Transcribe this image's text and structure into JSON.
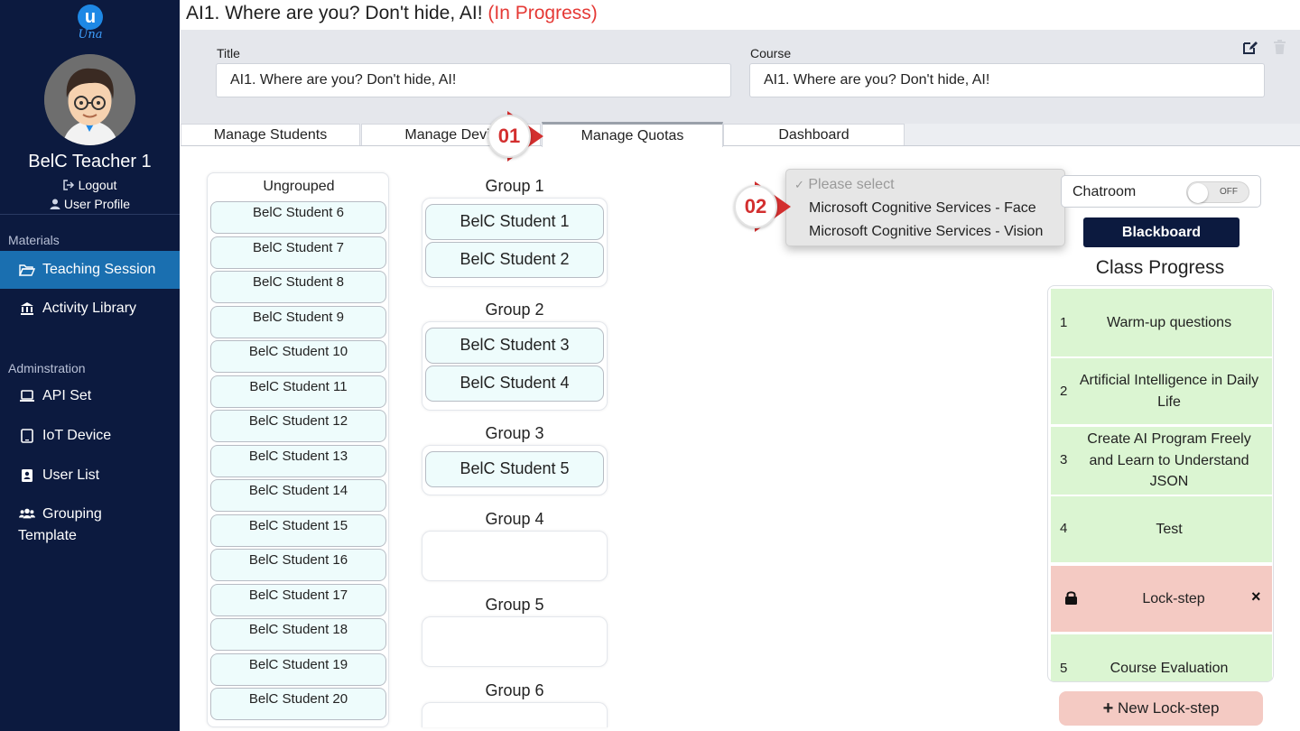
{
  "sidebar": {
    "logo_text": "Una",
    "teacher_name": "BelC Teacher 1",
    "logout_label": "Logout",
    "profile_label": "User Profile",
    "materials_label": "Materials",
    "admin_label": "Adminstration",
    "items": [
      {
        "label": "Teaching Session",
        "icon": "folder-open-icon",
        "active": true
      },
      {
        "label": "Activity Library",
        "icon": "library-icon",
        "active": false
      },
      {
        "label": "API Set",
        "icon": "laptop-icon",
        "active": false
      },
      {
        "label": "IoT Device",
        "icon": "tablet-icon",
        "active": false
      },
      {
        "label": "User List",
        "icon": "address-book-icon",
        "active": false
      },
      {
        "label_line1": "Grouping",
        "label_line2": "Template",
        "icon": "users-icon",
        "active": false
      }
    ]
  },
  "header": {
    "title": "AI1. Where are you? Don't hide, AI!",
    "status": "(In Progress)",
    "title_label": "Title",
    "title_value": "AI1. Where are you? Don't hide, AI!",
    "course_label": "Course",
    "course_value": "AI1. Where are you? Don't hide, AI!"
  },
  "tabs": [
    "Manage Students",
    "Manage Devic",
    "Manage Quotas",
    "Dashboard"
  ],
  "active_tab": "Manage Quotas",
  "callouts": [
    "01",
    "02"
  ],
  "ungrouped": {
    "title": "Ungrouped",
    "students": [
      "BelC Student 6",
      "BelC Student 7",
      "BelC Student 8",
      "BelC Student 9",
      "BelC Student 10",
      "BelC Student 11",
      "BelC Student 12",
      "BelC Student 13",
      "BelC Student 14",
      "BelC Student 15",
      "BelC Student 16",
      "BelC Student 17",
      "BelC Student 18",
      "BelC Student 19",
      "BelC Student 20"
    ]
  },
  "groups": [
    {
      "name": "Group 1",
      "students": [
        "BelC Student 1",
        "BelC Student 2"
      ]
    },
    {
      "name": "Group 2",
      "students": [
        "BelC Student 3",
        "BelC Student 4"
      ]
    },
    {
      "name": "Group 3",
      "students": [
        "BelC Student 5"
      ]
    },
    {
      "name": "Group 4",
      "students": []
    },
    {
      "name": "Group 5",
      "students": []
    },
    {
      "name": "Group 6",
      "students": []
    }
  ],
  "dropdown": {
    "placeholder": "Please select",
    "options": [
      "Microsoft Cognitive Services - Face",
      "Microsoft Cognitive Services - Vision"
    ]
  },
  "chatroom": {
    "label": "Chatroom",
    "toggle_state": "OFF"
  },
  "blackboard_label": "Blackboard",
  "class_progress": {
    "title": "Class Progress",
    "steps": [
      {
        "num": "1",
        "line1": "Warm-up questions"
      },
      {
        "num": "2",
        "line1": "Artificial Intelligence in Daily",
        "line2": "Life"
      },
      {
        "num": "3",
        "line1": "Create AI Program Freely",
        "line2": "and Learn to Understand",
        "line3": "JSON"
      },
      {
        "num": "4",
        "line1": "Test"
      },
      {
        "num": "",
        "line1": "Lock-step",
        "close": "×"
      },
      {
        "num": "5",
        "line1": "Course Evaluation"
      }
    ]
  },
  "new_lock_step_label": "New Lock-step",
  "colors": {
    "sidebar_bg": "#0c1a3f",
    "active_nav": "#1a6fb0",
    "status_red": "#e53935",
    "callout_red": "#d32f2f",
    "step_green": "#dbf5d2",
    "lock_pink": "#f4cac3"
  }
}
